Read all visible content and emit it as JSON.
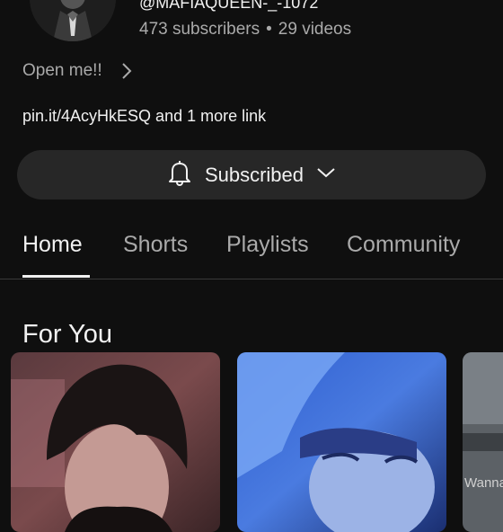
{
  "channel": {
    "handle": "@MAFIAQUEEN-_-1072",
    "subscribers": "473 subscribers",
    "separator": "•",
    "videos": "29 videos",
    "description_teaser": "Open me!!",
    "links_text": "pin.it/4AcyHkESQ and 1 more link"
  },
  "subscribe_button": {
    "label": "Subscribed",
    "icons": [
      "bell-icon",
      "chevron-down-icon"
    ]
  },
  "tabs": [
    {
      "label": "Home",
      "active": true
    },
    {
      "label": "Shorts",
      "active": false
    },
    {
      "label": "Playlists",
      "active": false
    },
    {
      "label": "Community",
      "active": false
    }
  ],
  "section": {
    "title": "For You"
  },
  "thumbnails": [
    {
      "overlay_text": ""
    },
    {
      "overlay_text": ""
    },
    {
      "overlay_text": "Wanna"
    }
  ],
  "colors": {
    "background": "#0f0f0f",
    "button_background": "#272727",
    "primary_text": "#f1f1f1",
    "secondary_text": "#aaaaaa"
  }
}
